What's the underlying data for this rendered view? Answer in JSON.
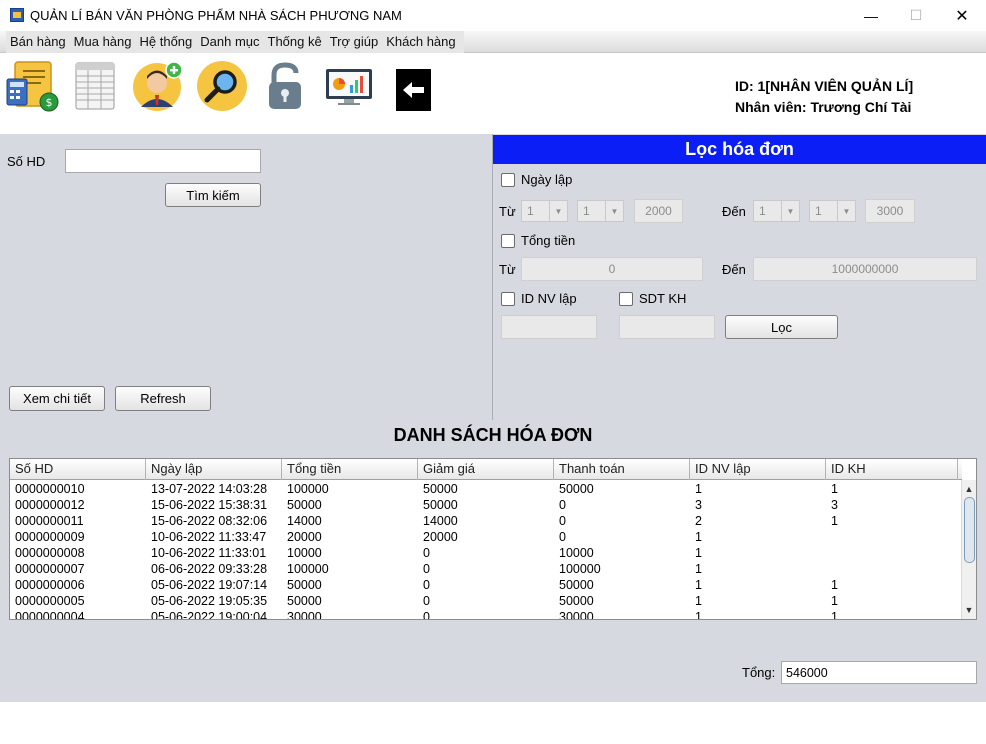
{
  "window": {
    "title": "QUẢN LÍ BÁN VĂN PHÒNG PHẨM NHÀ SÁCH PHƯƠNG NAM",
    "minimize_glyph": "—",
    "maximize_glyph": "☐",
    "close_glyph": "✕"
  },
  "menu": [
    "Bán hàng",
    "Mua hàng",
    "Hệ thống",
    "Danh mục",
    "Thống kê",
    "Trợ giúp",
    "Khách hàng"
  ],
  "toolbar": {
    "icons": [
      "invoice-calculator-icon",
      "spreadsheet-icon",
      "add-employee-icon",
      "search-magnifier-icon",
      "unlock-icon",
      "statistics-monitor-icon",
      "back-arrow-icon"
    ]
  },
  "user": {
    "id_line": "ID: 1[NHÂN VIÊN QUẢN LÍ]",
    "name_line": "Nhân viên: Trương Chí Tài"
  },
  "search": {
    "label": "Số HD",
    "value": "",
    "button": "Tìm kiếm"
  },
  "actions": {
    "detail": "Xem chi tiết",
    "refresh": "Refresh"
  },
  "filter": {
    "title": "Lọc hóa đơn",
    "date_label": "Ngày lập",
    "from_label": "Từ",
    "to_label": "Đến",
    "from_day": "1",
    "from_month": "1",
    "from_year": "2000",
    "to_day": "1",
    "to_month": "1",
    "to_year": "3000",
    "total_label": "Tổng tiền",
    "total_from": "0",
    "total_to": "1000000000",
    "staff_label": "ID NV lập",
    "phone_label": "SDT KH",
    "staff_value": "",
    "phone_value": "",
    "button": "Lọc"
  },
  "list": {
    "title": "DANH SÁCH HÓA ĐƠN",
    "columns": [
      "Số HD",
      "Ngày lập",
      "Tổng tiền",
      "Giảm giá",
      "Thanh toán",
      "ID NV lập",
      "ID KH"
    ],
    "rows": [
      [
        "0000000010",
        "13-07-2022 14:03:28",
        "100000",
        "50000",
        "50000",
        "1",
        "1"
      ],
      [
        "0000000012",
        "15-06-2022 15:38:31",
        "50000",
        "50000",
        "0",
        "3",
        "3"
      ],
      [
        "0000000011",
        "15-06-2022 08:32:06",
        "14000",
        "14000",
        "0",
        "2",
        "1"
      ],
      [
        "0000000009",
        "10-06-2022 11:33:47",
        "20000",
        "20000",
        "0",
        "1",
        ""
      ],
      [
        "0000000008",
        "10-06-2022 11:33:01",
        "10000",
        "0",
        "10000",
        "1",
        ""
      ],
      [
        "0000000007",
        "06-06-2022 09:33:28",
        "100000",
        "0",
        "100000",
        "1",
        ""
      ],
      [
        "0000000006",
        "05-06-2022 19:07:14",
        "50000",
        "0",
        "50000",
        "1",
        "1"
      ],
      [
        "0000000005",
        "05-06-2022 19:05:35",
        "50000",
        "0",
        "50000",
        "1",
        "1"
      ],
      [
        "0000000004",
        "05-06-2022 19:00:04",
        "30000",
        "0",
        "30000",
        "1",
        "1"
      ]
    ]
  },
  "total": {
    "label": "Tổng:",
    "value": "546000"
  },
  "colors": {
    "filter_header": "#0a1ef5",
    "panel_bg": "#d6d9df"
  }
}
